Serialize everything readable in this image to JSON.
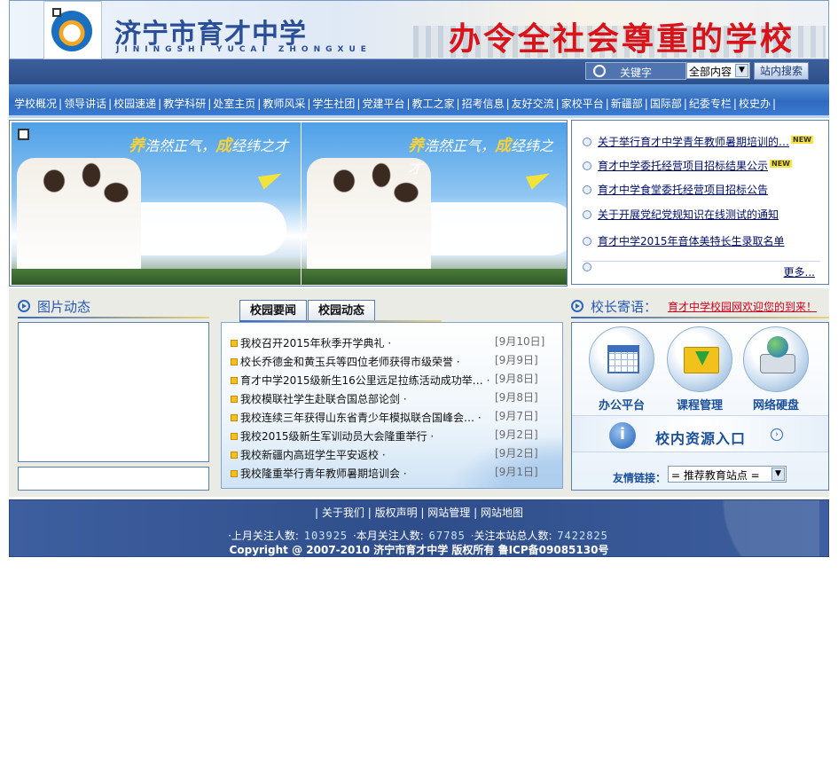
{
  "header": {
    "school_name_cn": "济宁市育才中学",
    "school_name_en": "JININGSHI YUCAI ZHONGXUE",
    "slogan": "办令全社会尊重的学校"
  },
  "search": {
    "keyword_placeholder": "关键字",
    "scope_selected": "全部内容",
    "search_button": "站内搜索"
  },
  "nav": {
    "items": [
      "学校概况",
      "领导讲话",
      "校园速递",
      "教学科研",
      "处室主页",
      "教师风采",
      "学生社团",
      "党建平台",
      "教工之家",
      "招考信息",
      "友好交流",
      "家校平台",
      "新疆部",
      "国际部",
      "纪委专栏",
      "校史办"
    ]
  },
  "banner": {
    "motto_a": "养",
    "motto_a_rest": "浩然正气，",
    "motto_b": "成",
    "motto_b_rest": "经纬之才"
  },
  "top_news": {
    "items": [
      {
        "title": "关于举行育才中学青年教师暑期培训的…",
        "new": true
      },
      {
        "title": "育才中学委托经营项目招标结果公示",
        "new": true
      },
      {
        "title": "育才中学食堂委托经营项目招标公告",
        "new": false
      },
      {
        "title": "关于开展党纪党规知识在线测试的通知",
        "new": false
      },
      {
        "title": "育才中学2015年音体美特长生录取名单",
        "new": false
      }
    ],
    "new_tag": "NEW",
    "more": "更多..."
  },
  "photo_section": {
    "title": "图片动态"
  },
  "campus_tabs": {
    "tab1": "校园要闻",
    "tab2": "校园动态"
  },
  "campus_news": [
    {
      "title": "我校召开2015年秋季开学典礼 ·",
      "date": "[9月10日]"
    },
    {
      "title": "校长乔德金和黄玉兵等四位老师获得市级荣誉 ·",
      "date": "[9月9日]"
    },
    {
      "title": "育才中学2015级新生16公里远足拉练活动成功举… ·",
      "date": "[9月8日]"
    },
    {
      "title": "我校模联社学生赴联合国总部论剑 ·",
      "date": "[9月8日]"
    },
    {
      "title": "我校连续三年获得山东省青少年模拟联合国峰会… ·",
      "date": "[9月7日]"
    },
    {
      "title": "我校2015级新生军训动员大会隆重举行 ·",
      "date": "[9月2日]"
    },
    {
      "title": "我校新疆内高班学生平安返校 ·",
      "date": "[9月2日]"
    },
    {
      "title": "我校隆重举行青年教师暑期培训会 ·",
      "date": "[9月1日]"
    }
  ],
  "principal": {
    "title": "校长寄语：",
    "message": "育才中学校园网欢迎您的到来！"
  },
  "tools": {
    "office": "办公平台",
    "course": "课程管理",
    "disk": "网络硬盘",
    "resource": "校内资源入口",
    "friend_label": "友情链接：",
    "friend_selected": "= 推荐教育站点 ="
  },
  "footer": {
    "links": [
      "关于我们",
      "版权声明",
      "网站管理",
      "网站地图"
    ],
    "last_month_label": "·上月关注人数:",
    "last_month_value": "103925",
    "this_month_label": "·本月关注人数:",
    "this_month_value": "67785",
    "total_label": "·关注本站总人数:",
    "total_value": "7422825",
    "copyright": "Copyright @ 2007-2010 济宁市育才中学 版权所有 鲁ICP备09085130号"
  }
}
